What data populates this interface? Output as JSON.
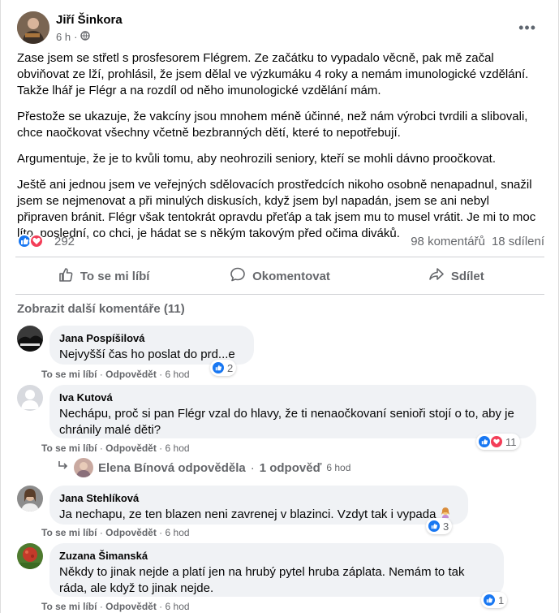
{
  "post": {
    "author": "Jiří Šinkora",
    "time": "6 h",
    "more_icon": "more-dots-icon",
    "paragraphs": [
      "Zase jsem se střetl s prosfesorem Flégrem. Ze začátku to vypadalo věcně, pak mě začal obviňovat ze lží, prohlásil, že jsem dělal ve výzkumáku 4 roky a nemám imunologické vzdělání. Takže lhář je Flégr a na rozdíl od něho imunologické vzdělání mám.",
      "Přestože se ukazuje, že vakcíny jsou mnohem méně účinné, než nám výrobci tvrdili a slibovali, chce naočkovat všechny včetně bezbranných dětí, které to nepotřebují.",
      "Argumentuje, že je to kvůli tomu, aby neohrozili seniory, kteří se mohli dávno proočkovat.",
      "Ještě ani jednou jsem ve veřejných sdělovacích prostředcích nikoho osobně nenapadnul, snažil jsem se nejmenovat a při minulých diskusích, když jsem byl napadán, jsem se ani nebyl připraven bránit. Flégr však tentokrát opravdu přeťáp a tak jsem mu to musel vrátit. Je mi to moc líto, poslední, co chci, je hádat se s někým takovým před očima diváků."
    ],
    "reaction_count": "292",
    "comments_count": "98 komentářů",
    "shares_count": "18 sdílení"
  },
  "actions": {
    "like": "To se mi líbí",
    "comment": "Okomentovat",
    "share": "Sdílet"
  },
  "comments_section": {
    "more_label": "Zobrazit další komentáře (11)",
    "like_label": "To se mi líbí",
    "reply_label": "Odpovědět",
    "separator": "·",
    "items": [
      {
        "name": "Jana Pospíšilová",
        "text": "Nejvyšší čas ho poslat do prd...e",
        "time": "6 hod",
        "reactions": "2"
      },
      {
        "name": "Iva Kutová",
        "text": "Nechápu, proč si pan Flégr vzal do hlavy, že ti nenaočkovaní senioři stojí o to, aby je chránily malé děti?",
        "time": "6 hod",
        "reactions": "11"
      },
      {
        "name": "Jana Stehlíková",
        "text": "Ja nechapu, ze ten blazen neni zavrenej v blazinci. Vzdyt tak i vypada",
        "time": "6 hod",
        "reactions": "3"
      },
      {
        "name": "Zuzana Šimanská",
        "text": "Někdy to jinak nejde a platí jen na hrubý pytel hruba záplata. Nemám to tak ráda, ale když to jinak nejde.",
        "time": "6 hod",
        "reactions": "1"
      }
    ],
    "reply": {
      "name": "Elena Bínová odpověděla",
      "count": "1 odpověď",
      "time": "6 hod"
    }
  },
  "colors": {
    "like_blue": "#1877f2",
    "love_red": "#f33e58",
    "secondary_text": "#65676b"
  }
}
